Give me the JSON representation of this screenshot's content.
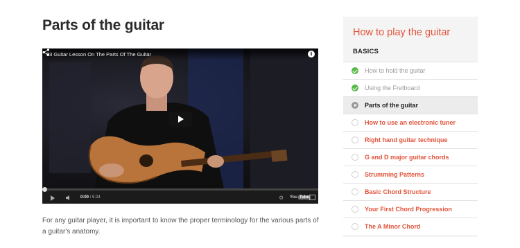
{
  "page": {
    "title": "Parts of the guitar",
    "description": "For any guitar player, it is important to know the proper terminology for the various parts of a guitar's anatomy."
  },
  "video": {
    "title": "03 Guitar Lesson On The Parts Of The Guitar",
    "current_time": "0:00",
    "duration": "/ 5:24",
    "progress": 0,
    "youtube_label": "You",
    "youtube_badge": "Tube",
    "info_glyph": "i",
    "gear_glyph": "⚙"
  },
  "sidebar": {
    "title": "How to play the guitar",
    "section": "BASICS",
    "accent_color": "#e1533b",
    "lessons": [
      {
        "label": "How to hold the guitar",
        "state": "done"
      },
      {
        "label": "Using the Fretboard",
        "state": "done"
      },
      {
        "label": "Parts of the guitar",
        "state": "current"
      },
      {
        "label": "How to use an electronic tuner",
        "state": "todo"
      },
      {
        "label": "Right hand guitar technique",
        "state": "todo"
      },
      {
        "label": "G and D major guitar chords",
        "state": "todo"
      },
      {
        "label": "Strumming Patterns",
        "state": "todo"
      },
      {
        "label": "Basic Chord Structure",
        "state": "todo"
      },
      {
        "label": "Your First Chord Progression",
        "state": "todo"
      },
      {
        "label": "The A Minor Chord",
        "state": "todo"
      }
    ]
  },
  "icons": {
    "share": "share-icon",
    "info": "info-icon",
    "play": "play-icon",
    "volume": "volume-icon",
    "settings": "gear-icon",
    "fullscreen": "fullscreen-icon",
    "done": "check-circle-icon",
    "current": "play-circle-icon",
    "todo": "empty-circle-icon"
  }
}
